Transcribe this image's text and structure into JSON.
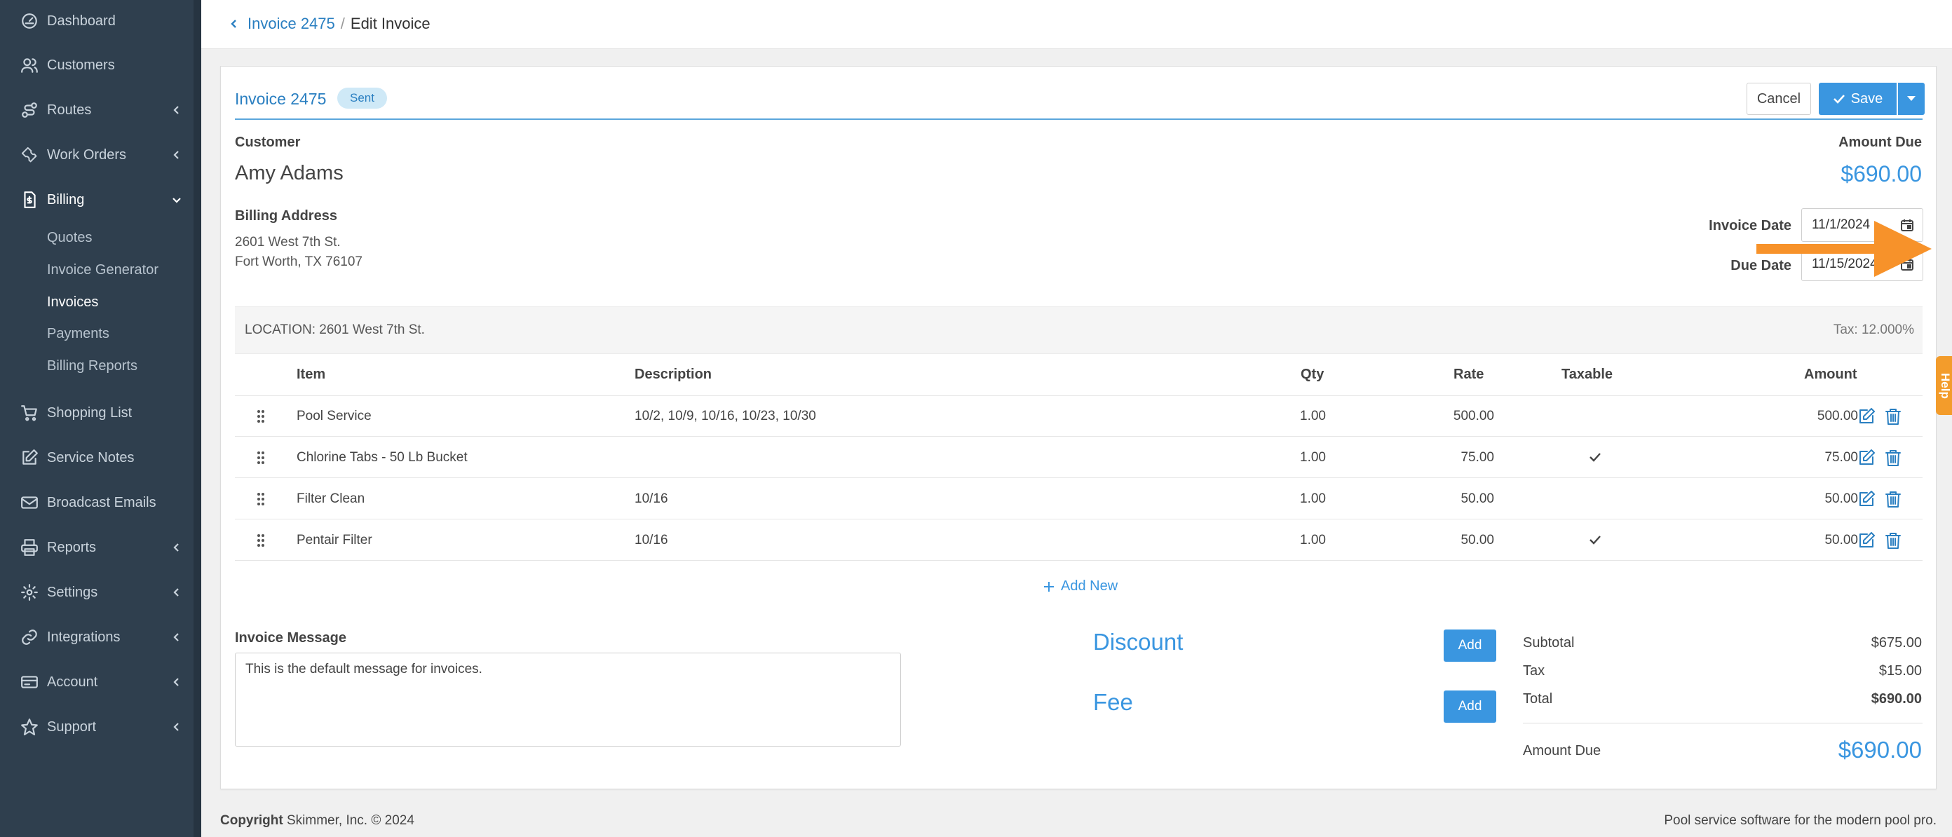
{
  "sidebar": {
    "items": [
      {
        "label": "Dashboard",
        "icon": "dashboard-icon"
      },
      {
        "label": "Customers",
        "icon": "customers-icon"
      },
      {
        "label": "Routes",
        "icon": "routes-icon"
      },
      {
        "label": "Work Orders",
        "icon": "wrench-icon"
      },
      {
        "label": "Billing",
        "icon": "billing-icon"
      },
      {
        "label": "Shopping List",
        "icon": "cart-icon"
      },
      {
        "label": "Service Notes",
        "icon": "edit-note-icon"
      },
      {
        "label": "Broadcast Emails",
        "icon": "envelope-icon"
      },
      {
        "label": "Reports",
        "icon": "printer-icon"
      },
      {
        "label": "Settings",
        "icon": "gear-icon"
      },
      {
        "label": "Integrations",
        "icon": "link-icon"
      },
      {
        "label": "Account",
        "icon": "card-icon"
      },
      {
        "label": "Support",
        "icon": "star-icon"
      }
    ],
    "billing_sub": [
      "Quotes",
      "Invoice Generator",
      "Invoices",
      "Payments",
      "Billing Reports"
    ]
  },
  "breadcrumb": {
    "parent": "Invoice 2475",
    "separator": "/",
    "current": "Edit Invoice"
  },
  "invoice": {
    "title": "Invoice 2475",
    "status": "Sent",
    "cancel_label": "Cancel",
    "save_label": "Save",
    "customer_label": "Customer",
    "customer_name": "Amy Adams",
    "amount_due_label": "Amount Due",
    "amount_due": "$690.00",
    "billing_address_label": "Billing Address",
    "address_line1": "2601 West 7th St.",
    "address_line2": "Fort Worth, TX 76107",
    "invoice_date_label": "Invoice Date",
    "invoice_date": "11/1/2024",
    "due_date_label": "Due Date",
    "due_date": "11/15/2024",
    "location": "LOCATION: 2601 West 7th St.",
    "tax_rate": "Tax: 12.000%"
  },
  "table": {
    "headers": {
      "item": "Item",
      "description": "Description",
      "qty": "Qty",
      "rate": "Rate",
      "taxable": "Taxable",
      "amount": "Amount"
    },
    "rows": [
      {
        "item": "Pool Service",
        "description": "10/2, 10/9, 10/16, 10/23, 10/30",
        "qty": "1.00",
        "rate": "500.00",
        "taxable": false,
        "amount": "500.00"
      },
      {
        "item": "Chlorine Tabs - 50 Lb Bucket",
        "description": "",
        "qty": "1.00",
        "rate": "75.00",
        "taxable": true,
        "amount": "75.00"
      },
      {
        "item": "Filter Clean",
        "description": "10/16",
        "qty": "1.00",
        "rate": "50.00",
        "taxable": false,
        "amount": "50.00"
      },
      {
        "item": "Pentair Filter",
        "description": "10/16",
        "qty": "1.00",
        "rate": "50.00",
        "taxable": true,
        "amount": "50.00"
      }
    ],
    "add_new_label": "Add New"
  },
  "message": {
    "label": "Invoice Message",
    "value": "This is the default message for invoices."
  },
  "adjustments": {
    "discount_label": "Discount",
    "fee_label": "Fee",
    "add_label": "Add"
  },
  "totals": {
    "subtotal_label": "Subtotal",
    "subtotal": "$675.00",
    "tax_label": "Tax",
    "tax": "$15.00",
    "total_label": "Total",
    "total": "$690.00",
    "amount_due_label": "Amount Due",
    "amount_due": "$690.00"
  },
  "help_label": "Help",
  "footer": {
    "copyright_label": "Copyright",
    "copyright_text": "Skimmer, Inc. © 2024",
    "tagline": "Pool service software for the modern pool pro."
  },
  "colors": {
    "sidebar": "#2f3f4e",
    "accent": "#3a96e0",
    "link": "#2a7fc1",
    "annotation_arrow": "#f7922a",
    "help_tab": "#f39c2b"
  }
}
